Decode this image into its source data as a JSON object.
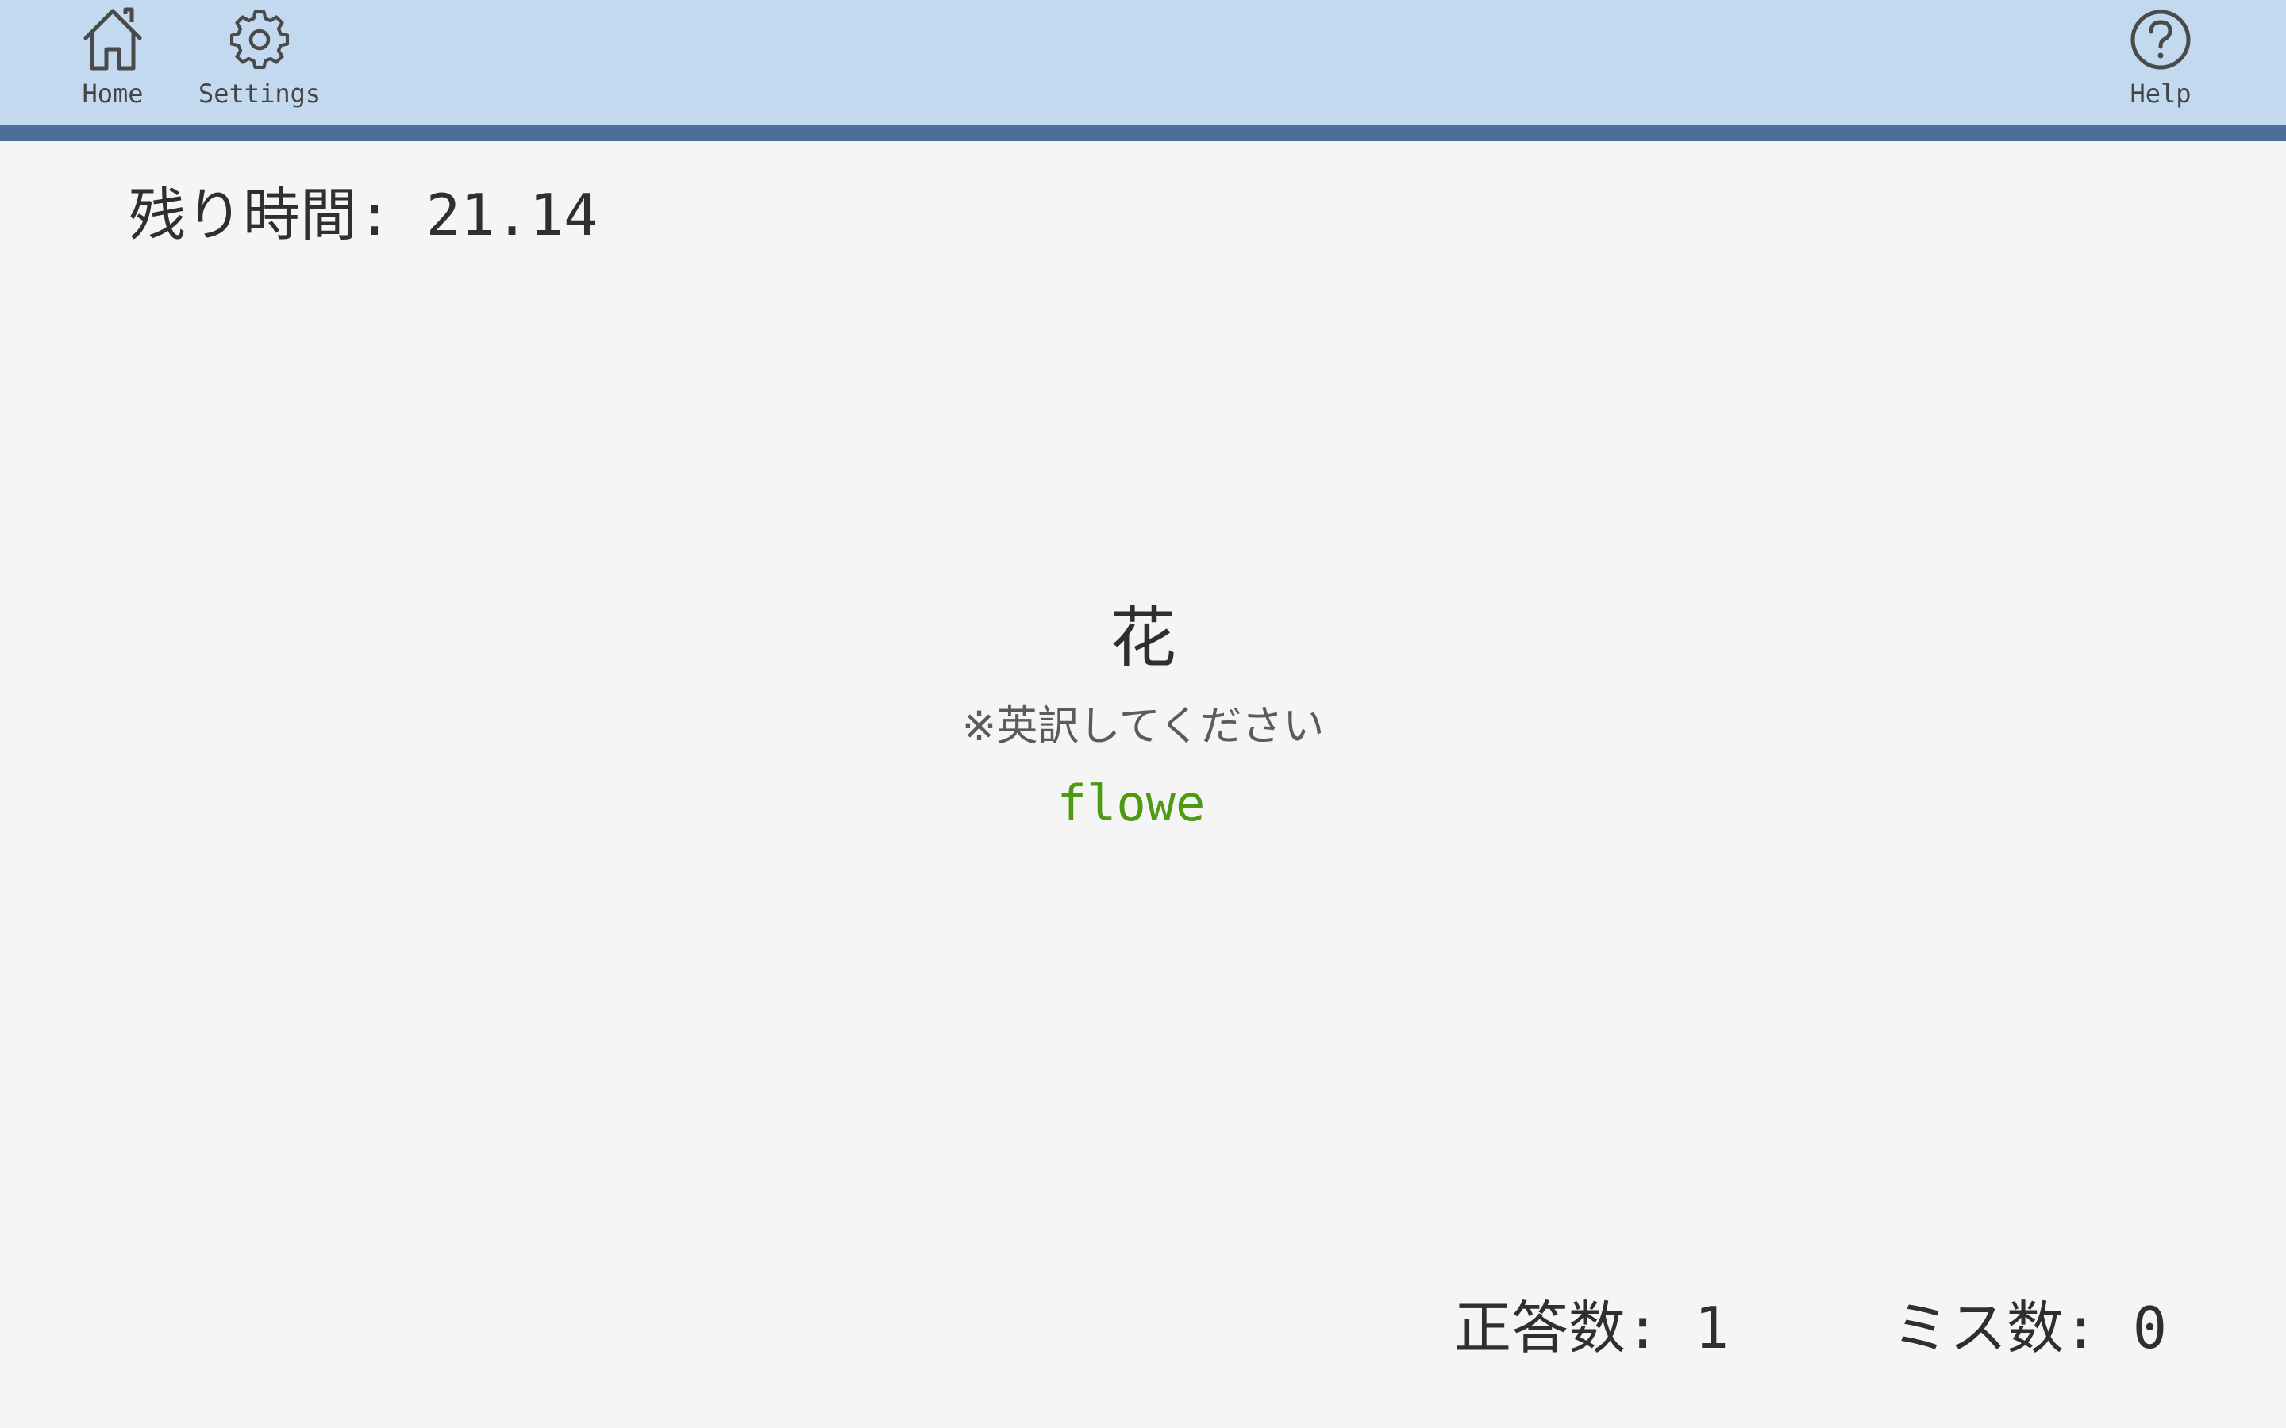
{
  "nav": {
    "home_label": "Home",
    "settings_label": "Settings",
    "help_label": "Help",
    "icons": {
      "home": "home-icon",
      "settings": "gear-icon",
      "help": "help-circle-icon"
    }
  },
  "timer": {
    "label": "残り時間: 21.14",
    "remaining_seconds": 21.14
  },
  "quiz": {
    "question": "花",
    "instruction": "※英訳してください",
    "typed_answer": "flowe"
  },
  "score": {
    "correct_text": "正答数: 1",
    "miss_text": "ミス数: 0"
  },
  "colors": {
    "header_bg": "#c2d9f0",
    "header_border": "#4a6f98",
    "page_bg": "#f5f5f5",
    "typed_answer": "#4f9a13"
  }
}
